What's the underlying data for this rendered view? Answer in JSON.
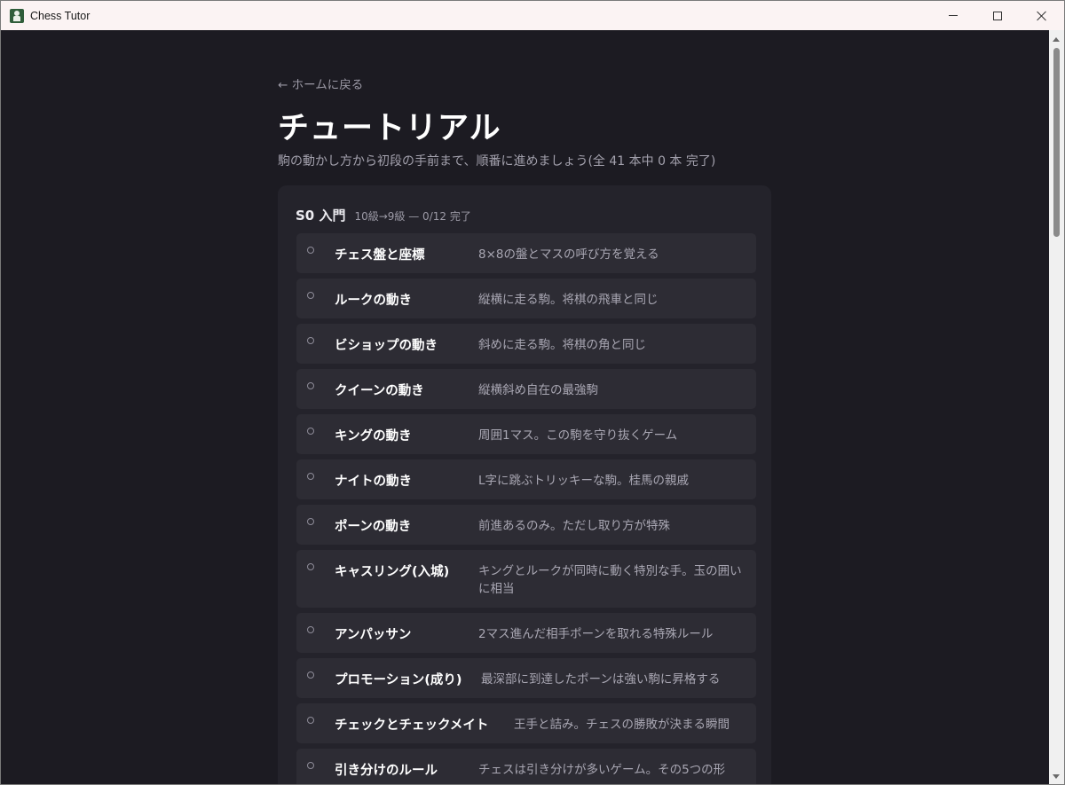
{
  "window": {
    "title": "Chess Tutor",
    "icon": "chess-pawn-icon"
  },
  "nav": {
    "back_label": "← ホームに戻る"
  },
  "page": {
    "title": "チュートリアル",
    "subtitle": "駒の動かし方から初段の手前まで、順番に進めましょう(全 41 本中 0 本 完了)"
  },
  "section": {
    "name": "S0 入門",
    "meta": "10級→9級 — 0/12 完了",
    "lessons": [
      {
        "title": "チェス盤と座標",
        "desc": "8×8の盤とマスの呼び方を覚える",
        "status_icon": "circle-outline-icon"
      },
      {
        "title": "ルークの動き",
        "desc": "縦横に走る駒。将棋の飛車と同じ",
        "status_icon": "circle-outline-icon"
      },
      {
        "title": "ビショップの動き",
        "desc": "斜めに走る駒。将棋の角と同じ",
        "status_icon": "circle-outline-icon"
      },
      {
        "title": "クイーンの動き",
        "desc": "縦横斜め自在の最強駒",
        "status_icon": "circle-outline-icon"
      },
      {
        "title": "キングの動き",
        "desc": "周囲1マス。この駒を守り抜くゲーム",
        "status_icon": "circle-outline-icon"
      },
      {
        "title": "ナイトの動き",
        "desc": "L字に跳ぶトリッキーな駒。桂馬の親戚",
        "status_icon": "circle-outline-icon"
      },
      {
        "title": "ポーンの動き",
        "desc": "前進あるのみ。ただし取り方が特殊",
        "status_icon": "circle-outline-icon"
      },
      {
        "title": "キャスリング(入城)",
        "desc": "キングとルークが同時に動く特別な手。玉の囲いに相当",
        "status_icon": "circle-outline-icon"
      },
      {
        "title": "アンパッサン",
        "desc": "2マス進んだ相手ポーンを取れる特殊ルール",
        "status_icon": "circle-outline-icon"
      },
      {
        "title": "プロモーション(成り)",
        "desc": "最深部に到達したポーンは強い駒に昇格する",
        "status_icon": "circle-outline-icon"
      },
      {
        "title": "チェックとチェックメイト",
        "desc": "王手と詰み。チェスの勝敗が決まる瞬間",
        "status_icon": "circle-outline-icon"
      },
      {
        "title": "引き分けのルール",
        "desc": "チェスは引き分けが多いゲーム。その5つの形",
        "status_icon": "circle-outline-icon"
      }
    ]
  }
}
